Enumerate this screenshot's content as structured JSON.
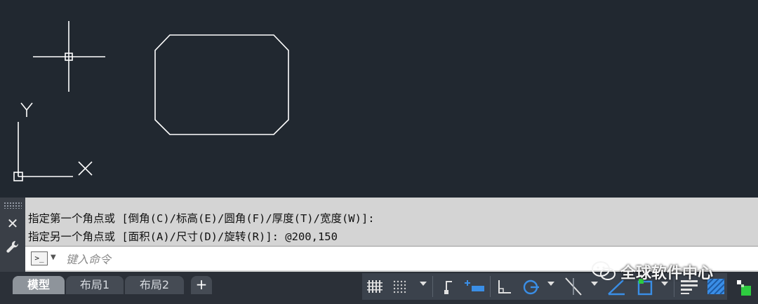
{
  "canvas": {
    "ucs": {
      "x_label": "X",
      "y_label": "Y"
    }
  },
  "command": {
    "history": [
      "指定第一个角点或 [倒角(C)/标高(E)/圆角(F)/厚度(T)/宽度(W)]:",
      "指定另一个角点或 [面积(A)/尺寸(D)/旋转(R)]: @200,150"
    ],
    "prompt_icon": ">_",
    "input_placeholder": "键入命令",
    "input_value": ""
  },
  "tabs": [
    {
      "label": "模型",
      "active": true
    },
    {
      "label": "布局1",
      "active": false
    },
    {
      "label": "布局2",
      "active": false
    }
  ],
  "add_tab_label": "+",
  "status_tools": [
    "grid-display-icon",
    "snap-mode-icon",
    "infer-constraints-icon",
    "dynamic-input-icon",
    "ortho-mode-icon",
    "polar-tracking-icon",
    "isometric-drafting-icon",
    "object-snap-tracking-icon",
    "object-snap-icon",
    "lineweight-icon",
    "transparency-icon",
    "selection-cycling-icon"
  ],
  "watermark": {
    "text": "全球软件中心"
  },
  "colors": {
    "canvas_bg": "#212830",
    "geometry": "#ffffff",
    "accent_blue": "#3a8ee6"
  }
}
